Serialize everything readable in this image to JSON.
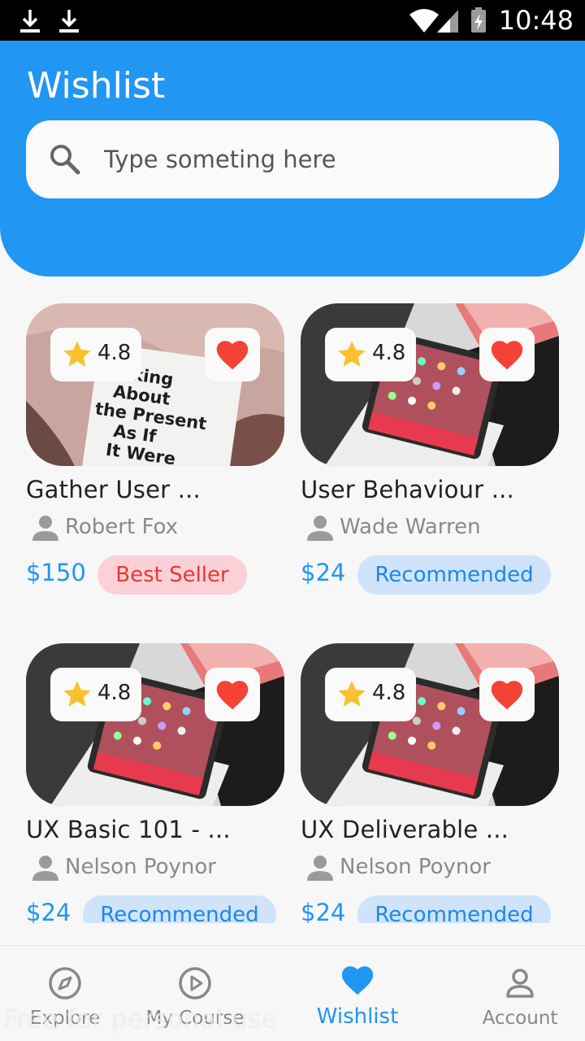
{
  "status_bar": {
    "time": "10:48",
    "icons": [
      "download-icon",
      "download-icon",
      "wifi-icon",
      "signal-icon",
      "battery-icon"
    ]
  },
  "header": {
    "title": "Wishlist",
    "search_placeholder": "Type someting here"
  },
  "courses": [
    {
      "rating": "4.8",
      "name": "Gather User ...",
      "author": "Robert Fox",
      "price": "$150",
      "badge": "Best Seller",
      "badge_style": "red",
      "image": "book-photo",
      "favorite": true
    },
    {
      "rating": "4.8",
      "name": "User Behaviour ...",
      "author": "Wade Warren",
      "price": "$24",
      "badge": "Recommended",
      "badge_style": "blue",
      "image": "phone-photo",
      "favorite": true
    },
    {
      "rating": "4.8",
      "name": "UX Basic 101 - ...",
      "author": "Nelson Poynor",
      "price": "$24",
      "badge": "Recommended",
      "badge_style": "blue",
      "image": "phone-photo",
      "favorite": true
    },
    {
      "rating": "4.8",
      "name": "UX Deliverable ...",
      "author": "Nelson Poynor",
      "price": "$24",
      "badge": "Recommended",
      "badge_style": "blue",
      "image": "phone-photo",
      "favorite": true
    }
  ],
  "book_text": "nking\nAbout\nthe Present\nAs If\nIt Were",
  "bottom_nav": {
    "active": "Wishlist",
    "items": [
      {
        "label": "Explore",
        "icon": "compass-icon"
      },
      {
        "label": "My Course",
        "icon": "play-circle-icon"
      },
      {
        "label": "Wishlist",
        "icon": "heart-icon"
      },
      {
        "label": "Account",
        "icon": "person-icon"
      }
    ]
  },
  "watermark": "Free for personal use",
  "colors": {
    "primary": "#2196f3",
    "favorite": "#f44336",
    "star": "#fbc02d",
    "best_seller_bg": "#fbd0d6",
    "best_seller_text": "#e53935",
    "recommended_bg": "#cfe3fb",
    "recommended_text": "#1e88e5"
  }
}
